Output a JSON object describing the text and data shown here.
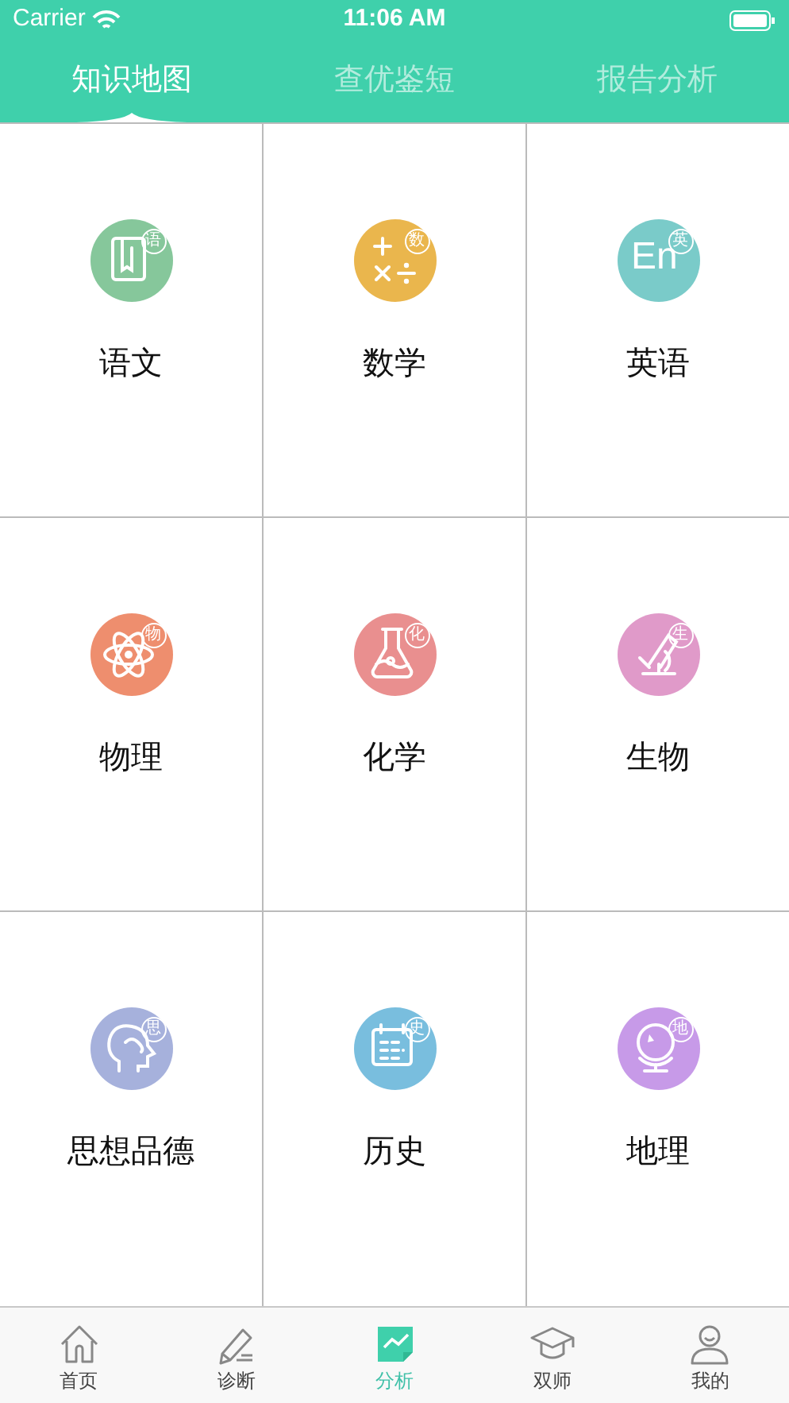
{
  "status_bar": {
    "carrier": "Carrier",
    "time": "11:06 AM"
  },
  "tabs": [
    {
      "label": "知识地图",
      "selected": true
    },
    {
      "label": "查优鉴短",
      "selected": false
    },
    {
      "label": "报告分析",
      "selected": false
    }
  ],
  "subjects": [
    {
      "label": "语文",
      "badge": "语",
      "color": "#86c79b"
    },
    {
      "label": "数学",
      "badge": "数",
      "color": "#eab64d"
    },
    {
      "label": "英语",
      "badge": "英",
      "icon_text": "En",
      "color": "#7acbc9"
    },
    {
      "label": "物理",
      "badge": "物",
      "color": "#ee8e6e"
    },
    {
      "label": "化学",
      "badge": "化",
      "color": "#e98f8f"
    },
    {
      "label": "生物",
      "badge": "生",
      "color": "#e09ac9"
    },
    {
      "label": "思想品德",
      "badge": "思",
      "color": "#a6b1dc"
    },
    {
      "label": "历史",
      "badge": "史",
      "color": "#79bede"
    },
    {
      "label": "地理",
      "badge": "地",
      "color": "#c79ae8"
    }
  ],
  "bottom_nav": [
    {
      "label": "首页",
      "selected": false
    },
    {
      "label": "诊断",
      "selected": false
    },
    {
      "label": "分析",
      "selected": true
    },
    {
      "label": "双师",
      "selected": false
    },
    {
      "label": "我的",
      "selected": false
    }
  ]
}
